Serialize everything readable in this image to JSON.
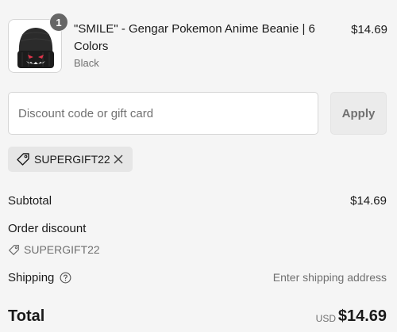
{
  "product": {
    "quantity": "1",
    "title": "\"SMILE\" - Gengar Pokemon Anime Beanie | 6 Colors",
    "variant": "Black",
    "price": "$14.69",
    "image_icon": "beanie-product-image"
  },
  "discount": {
    "placeholder": "Discount code or gift card",
    "value": "",
    "apply_label": "Apply",
    "applied_code": "SUPERGIFT22"
  },
  "summary": {
    "subtotal_label": "Subtotal",
    "subtotal_value": "$14.69",
    "order_discount_label": "Order discount",
    "order_discount_code": "SUPERGIFT22",
    "shipping_label": "Shipping",
    "shipping_value": "Enter shipping address",
    "total_label": "Total",
    "currency": "USD",
    "total_value": "$14.69"
  },
  "colors": {
    "background": "#f5f5f5",
    "text": "#1a1a1a",
    "muted_text": "#707070",
    "badge": "#666666"
  }
}
